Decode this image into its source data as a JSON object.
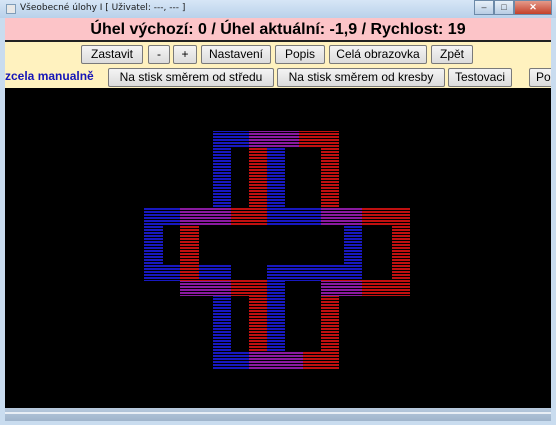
{
  "window": {
    "title": "Všeobecné úlohy I [ Uživatel: ---, --- ]",
    "minimize_label": "–",
    "maximize_label": "□",
    "close_label": "✕"
  },
  "header": {
    "text": "Úhel výchozí: 0 / Úhel aktuální: -1,9 / Rychlost: 19"
  },
  "toolbar": {
    "buttons": [
      {
        "label": "Zastavit"
      },
      {
        "label": "-"
      },
      {
        "label": "+"
      },
      {
        "label": "Nastavení"
      },
      {
        "label": "Popis"
      },
      {
        "label": "Celá obrazovka"
      },
      {
        "label": "Zpět"
      }
    ]
  },
  "modebar": {
    "active_label": "zcela manualně",
    "buttons": [
      {
        "label": "Na stisk směrem od středu"
      },
      {
        "label": "Na stisk směrem od kresby"
      },
      {
        "label": "Testovaci"
      },
      {
        "label": "Po"
      }
    ]
  },
  "canvas": {
    "colors": {
      "background": "#000000",
      "red": "#c01010",
      "blue": "#1818c0",
      "overlap": "#8a1aa0"
    }
  }
}
